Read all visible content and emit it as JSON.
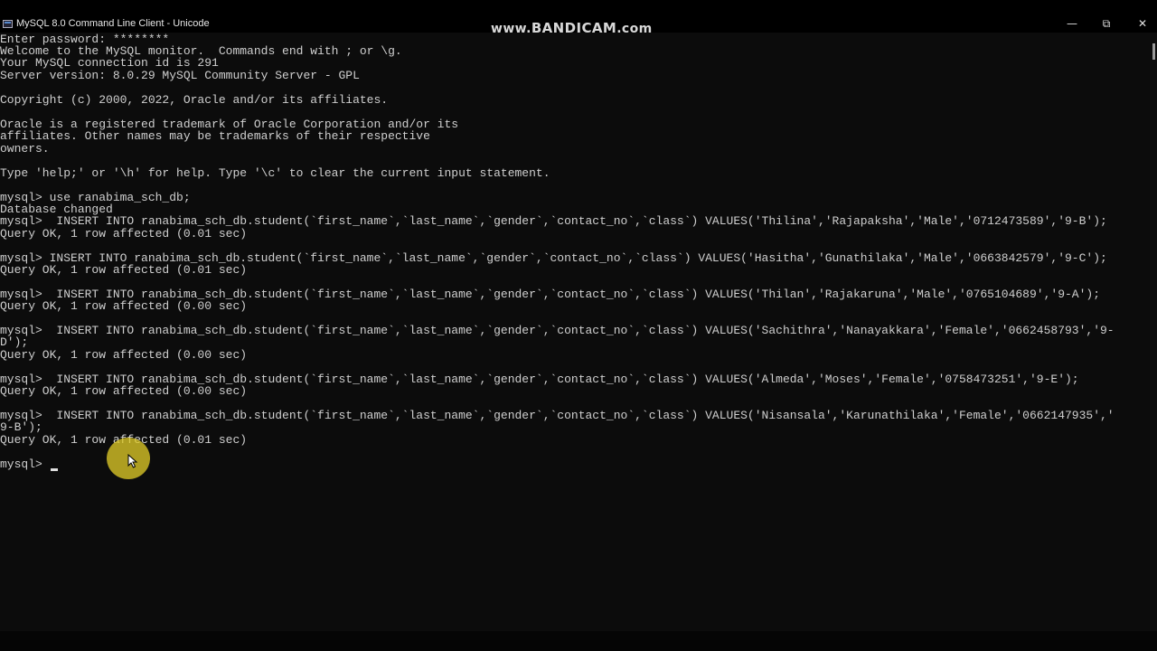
{
  "window": {
    "title": "MySQL 8.0 Command Line Client - Unicode",
    "icon": "terminal-app-icon",
    "controls": {
      "minimize": "—",
      "maximize": "⧉",
      "close": "✕"
    }
  },
  "watermark": {
    "prefix": "www.",
    "brand": "BANDICAM",
    "suffix": ".com"
  },
  "terminal": {
    "lines": [
      "Enter password: ********",
      "Welcome to the MySQL monitor.  Commands end with ; or \\g.",
      "Your MySQL connection id is 291",
      "Server version: 8.0.29 MySQL Community Server - GPL",
      "Copyright (c) 2000, 2022, Oracle and/or its affiliates.",
      "Oracle is a registered trademark of Oracle Corporation and/or its",
      "affiliates. Other names may be trademarks of their respective",
      "owners.",
      "Type 'help;' or '\\h' for help. Type '\\c' to clear the current input statement.",
      "mysql> use ranabima_sch_db;",
      "Database changed",
      "mysql>  INSERT INTO ranabima_sch_db.student(`first_name`,`last_name`,`gender`,`contact_no`,`class`) VALUES('Thilina','Rajapaksha','Male','0712473589','9-B');",
      "Query OK, 1 row affected (0.01 sec)",
      "mysql> INSERT INTO ranabima_sch_db.student(`first_name`,`last_name`,`gender`,`contact_no`,`class`) VALUES('Hasitha','Gunathilaka','Male','0663842579','9-C');",
      "Query OK, 1 row affected (0.01 sec)",
      "mysql>  INSERT INTO ranabima_sch_db.student(`first_name`,`last_name`,`gender`,`contact_no`,`class`) VALUES('Thilan','Rajakaruna','Male','0765104689','9-A');",
      "Query OK, 1 row affected (0.00 sec)",
      "mysql>  INSERT INTO ranabima_sch_db.student(`first_name`,`last_name`,`gender`,`contact_no`,`class`) VALUES('Sachithra','Nanayakkara','Female','0662458793','9-",
      "D');",
      "Query OK, 1 row affected (0.00 sec)",
      "mysql>  INSERT INTO ranabima_sch_db.student(`first_name`,`last_name`,`gender`,`contact_no`,`class`) VALUES('Almeda','Moses','Female','0758473251','9-E');",
      "Query OK, 1 row affected (0.00 sec)",
      "mysql>  INSERT INTO ranabima_sch_db.student(`first_name`,`last_name`,`gender`,`contact_no`,`class`) VALUES('Nisansala','Karunathilaka','Female','0662147935','",
      "9-B');",
      "Query OK, 1 row affected (0.01 sec)",
      "mysql> "
    ]
  }
}
